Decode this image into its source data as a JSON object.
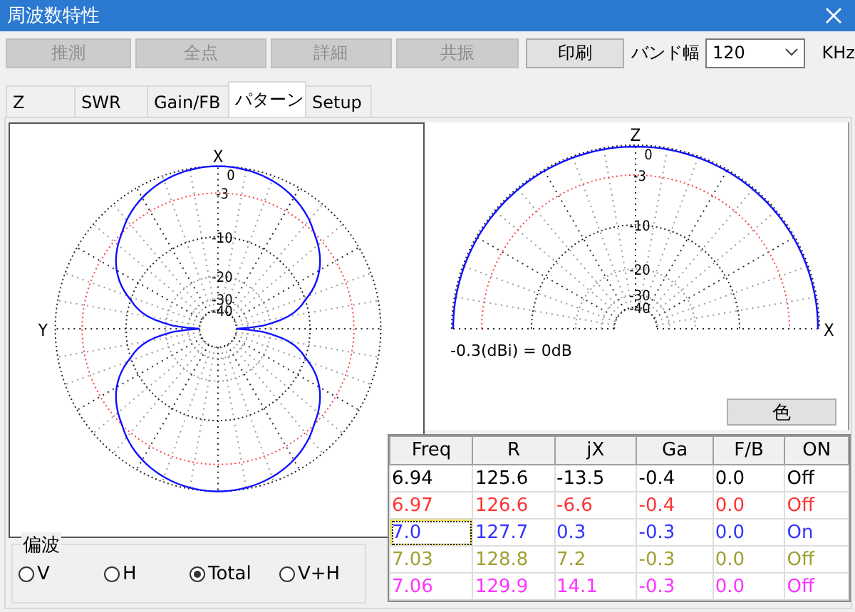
{
  "window": {
    "title": "周波数特性"
  },
  "toolbar": {
    "buttons": [
      {
        "label": "推測",
        "disabled": true
      },
      {
        "label": "全点",
        "disabled": true
      },
      {
        "label": "詳細",
        "disabled": true
      },
      {
        "label": "共振",
        "disabled": true
      },
      {
        "label": "印刷",
        "disabled": false
      }
    ],
    "bandwidth": {
      "label": "バンド幅",
      "value": "120",
      "unit": "KHz"
    }
  },
  "tabs": [
    {
      "label": "Z",
      "selected": false
    },
    {
      "label": "SWR",
      "selected": false
    },
    {
      "label": "Gain/FB",
      "selected": false
    },
    {
      "label": "パターン",
      "selected": true
    },
    {
      "label": "Setup",
      "selected": false
    }
  ],
  "horizontal_plot": {
    "axis_top": "X",
    "axis_left": "Y",
    "ring_labels": [
      "0",
      "-3",
      "-10",
      "-20",
      "-30",
      "-40"
    ]
  },
  "vertical_plot": {
    "axis_top": "Z",
    "axis_right": "X",
    "ring_labels": [
      "0",
      "-3",
      "-10",
      "-20",
      "-30",
      "-40"
    ],
    "reference": "-0.3(dBi) = 0dB"
  },
  "color_button": "色",
  "table": {
    "columns": [
      "Freq",
      "R",
      "jX",
      "Ga",
      "F/B",
      "ON"
    ],
    "rows": [
      {
        "color": "#000000",
        "selected": false,
        "cells": [
          "6.94",
          "125.6",
          "-13.5",
          "-0.4",
          "0.0",
          "Off"
        ]
      },
      {
        "color": "#ff3333",
        "selected": false,
        "cells": [
          "6.97",
          "126.6",
          "-6.6",
          "-0.4",
          "0.0",
          "Off"
        ]
      },
      {
        "color": "#3333ff",
        "selected": true,
        "cells": [
          "7.0",
          "127.7",
          "0.3",
          "-0.3",
          "0.0",
          "On"
        ]
      },
      {
        "color": "#a0a032",
        "selected": false,
        "cells": [
          "7.03",
          "128.8",
          "7.2",
          "-0.3",
          "0.0",
          "Off"
        ]
      },
      {
        "color": "#ff33ff",
        "selected": false,
        "cells": [
          "7.06",
          "129.9",
          "14.1",
          "-0.3",
          "0.0",
          "Off"
        ]
      }
    ]
  },
  "polarization": {
    "title": "偏波",
    "options": [
      {
        "label": "V",
        "selected": false
      },
      {
        "label": "H",
        "selected": false
      },
      {
        "label": "Total",
        "selected": true
      },
      {
        "label": "V+H",
        "selected": false
      }
    ]
  }
}
